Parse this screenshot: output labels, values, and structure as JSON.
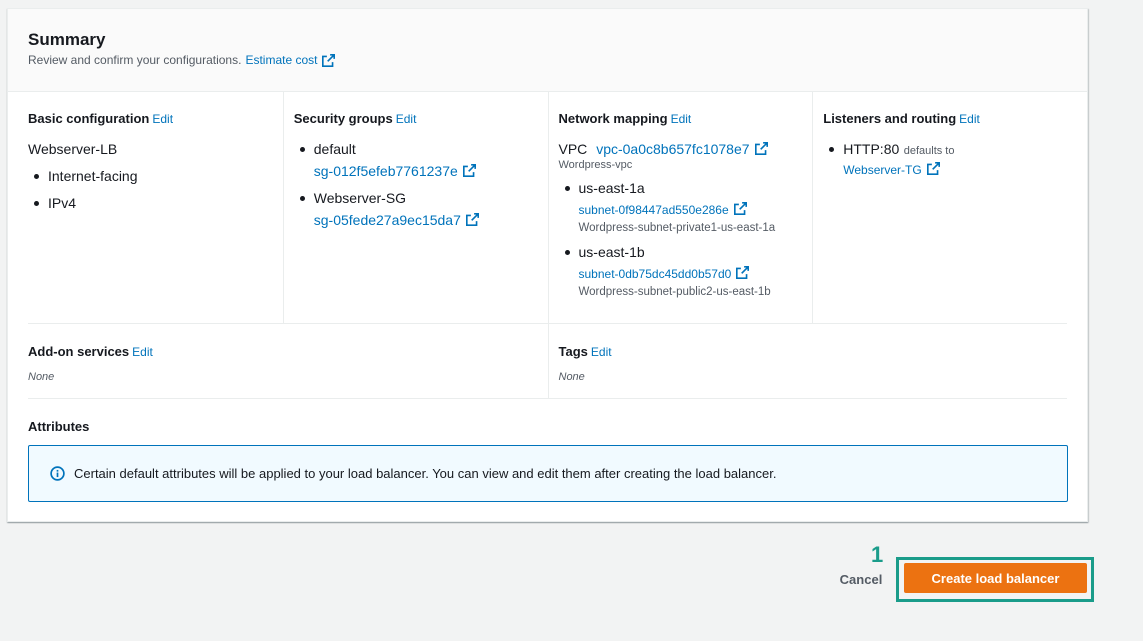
{
  "summary": {
    "title": "Summary",
    "description": "Review and confirm your configurations.",
    "estimate_link": "Estimate cost",
    "edit_label": "Edit"
  },
  "basic_configuration": {
    "title": "Basic configuration",
    "name": "Webserver-LB",
    "items": [
      "Internet-facing",
      "IPv4"
    ]
  },
  "security_groups": {
    "title": "Security groups",
    "groups": [
      {
        "name": "default",
        "id": "sg-012f5efeb7761237e"
      },
      {
        "name": "Webserver-SG",
        "id": "sg-05fede27a9ec15da7"
      }
    ]
  },
  "network_mapping": {
    "title": "Network mapping",
    "vpc_label": "VPC",
    "vpc_id": "vpc-0a0c8b657fc1078e7",
    "vpc_name": "Wordpress-vpc",
    "zones": [
      {
        "zone": "us-east-1a",
        "subnet_id": "subnet-0f98447ad550e286e",
        "subnet_name": "Wordpress-subnet-private1-us-east-1a"
      },
      {
        "zone": "us-east-1b",
        "subnet_id": "subnet-0db75dc45dd0b57d0",
        "subnet_name": "Wordpress-subnet-public2-us-east-1b"
      }
    ]
  },
  "listeners": {
    "title": "Listeners and routing",
    "listener": "HTTP:80",
    "defaults_to": "defaults to",
    "target_group": "Webserver-TG"
  },
  "addon_services": {
    "title": "Add-on services",
    "value": "None"
  },
  "tags": {
    "title": "Tags",
    "value": "None"
  },
  "attributes": {
    "title": "Attributes",
    "info": "Certain default attributes will be applied to your load balancer. You can view and edit them after creating the load balancer."
  },
  "footer": {
    "step_number": "1",
    "cancel_label": "Cancel",
    "create_label": "Create load balancer",
    "accent_color": "#ec7211",
    "highlight_color": "#1a9c8a"
  }
}
